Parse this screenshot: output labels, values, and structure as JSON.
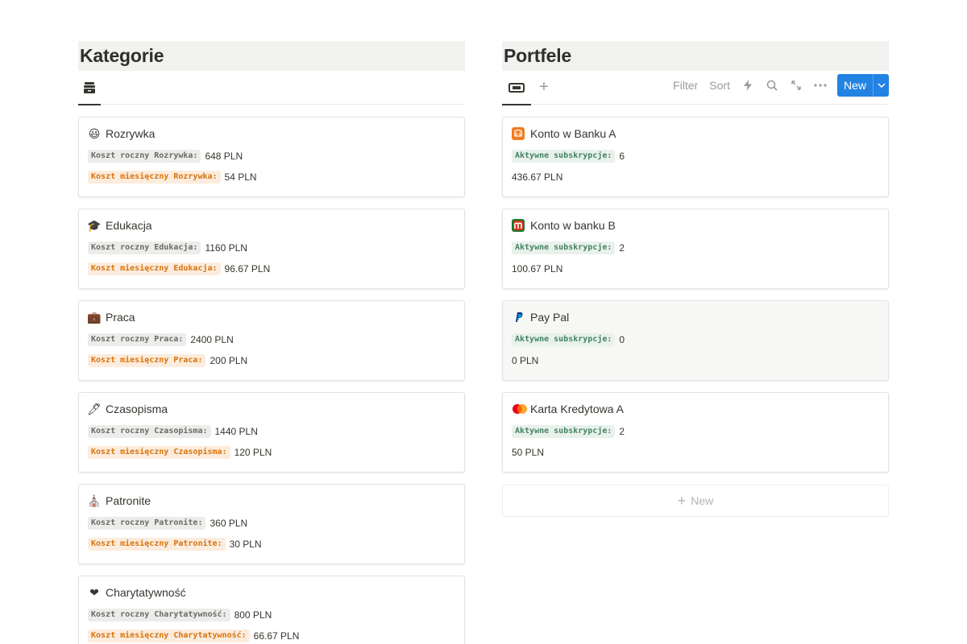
{
  "left": {
    "title": "Kategorie",
    "view_icon": "archive-icon",
    "cards": [
      {
        "icon": "😃",
        "icon_name": "smiley-icon",
        "name": "Rozrywka",
        "yearly_label": "Koszt roczny Rozrywka:",
        "yearly_value": "648 PLN",
        "monthly_label": "Koszt miesięczny Rozrywka:",
        "monthly_value": "54 PLN"
      },
      {
        "icon": "🎓",
        "icon_name": "graduation-cap-icon",
        "name": "Edukacja",
        "yearly_label": "Koszt roczny Edukacja:",
        "yearly_value": "1160 PLN",
        "monthly_label": "Koszt miesięczny Edukacja:",
        "monthly_value": "96.67 PLN"
      },
      {
        "icon": "💼",
        "icon_name": "briefcase-icon",
        "name": "Praca",
        "yearly_label": "Koszt roczny Praca:",
        "yearly_value": "2400 PLN",
        "monthly_label": "Koszt miesięczny Praca:",
        "monthly_value": "200 PLN"
      },
      {
        "icon": "🖊",
        "icon_name": "pen-icon",
        "name": "Czasopisma",
        "yearly_label": "Koszt roczny Czasopisma:",
        "yearly_value": "1440 PLN",
        "monthly_label": "Koszt miesięczny Czasopisma:",
        "monthly_value": "120 PLN"
      },
      {
        "icon": "⛪",
        "icon_name": "building-icon",
        "name": "Patronite",
        "yearly_label": "Koszt roczny Patronite:",
        "yearly_value": "360 PLN",
        "monthly_label": "Koszt miesięczny Patronite:",
        "monthly_value": "30 PLN"
      },
      {
        "icon": "❤",
        "icon_name": "heart-icon",
        "name": "Charytatywność",
        "yearly_label": "Koszt roczny Charytatywność:",
        "yearly_value": "800 PLN",
        "monthly_label": "Koszt miesięczny Charytatywność:",
        "monthly_value": "66.67 PLN"
      }
    ]
  },
  "right": {
    "title": "Portfele",
    "view_icon": "wallet-icon",
    "toolbar": {
      "filter": "Filter",
      "sort": "Sort",
      "new": "New"
    },
    "cards": [
      {
        "icon_name": "bank-a-icon",
        "icon_color": "#f07d22",
        "name": "Konto w Banku A",
        "subs_label": "Aktywne subskrypcje:",
        "subs_value": "6",
        "amount": "436.67 PLN"
      },
      {
        "icon_name": "bank-b-icon",
        "icon_color": "#d4351c",
        "name": "Konto w banku B",
        "subs_label": "Aktywne subskrypcje:",
        "subs_value": "2",
        "amount": "100.67 PLN"
      },
      {
        "icon_name": "paypal-icon",
        "icon_color": "#003087",
        "name": "Pay Pal",
        "subs_label": "Aktywne subskrypcje:",
        "subs_value": "0",
        "amount": "0 PLN"
      },
      {
        "icon_name": "credit-card-icon",
        "icon_color": "#eb001b",
        "name": "Karta Kredytowa A",
        "subs_label": "Aktywne subskrypcje:",
        "subs_value": "2",
        "amount": "50 PLN"
      }
    ],
    "new_row_label": "New"
  },
  "colors": {
    "accent": "#2383e2",
    "header_bg": "#f1f1ef",
    "code_orange": "#d9730d",
    "code_green": "#448361"
  }
}
